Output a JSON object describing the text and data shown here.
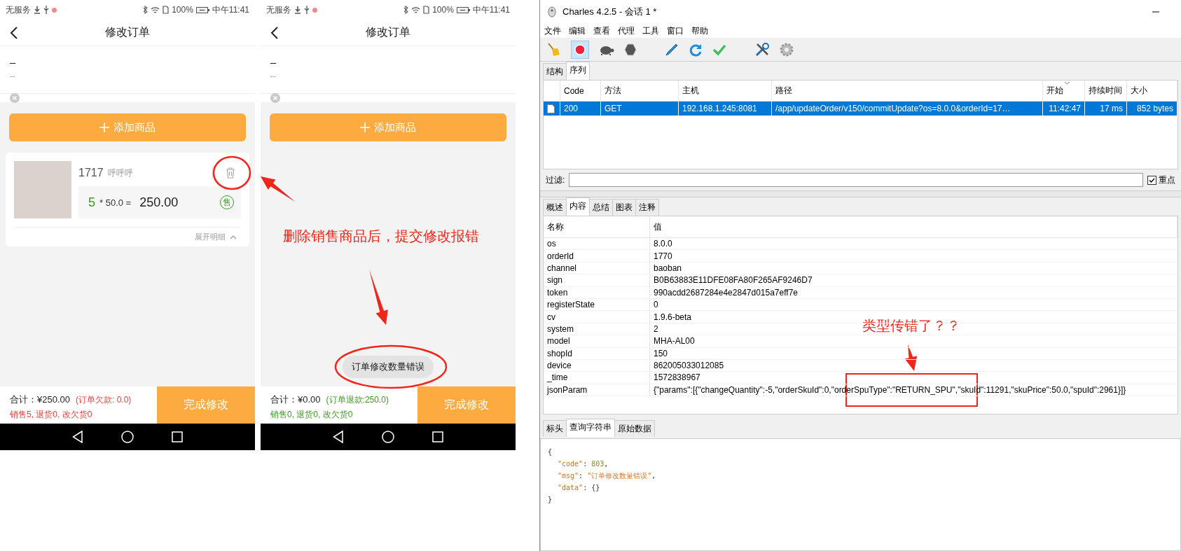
{
  "phones": [
    {
      "status_bar": {
        "carrier": "无服务",
        "battery": "100%",
        "time": "中午11:41"
      },
      "title": "修改订单",
      "customer": {
        "name": "–",
        "phone": "--"
      },
      "add_button": "添加商品",
      "items": [
        {
          "code": "1717",
          "name": "呼呼呼",
          "quantity": "5",
          "price": "* 50.0 =",
          "total": "250.00",
          "tag": "售",
          "expand": "展开明细"
        }
      ],
      "footer": {
        "total": "合计：¥250.00",
        "balance": "(订单欠款: 0.0)",
        "summary": "销售5, 退货0, 改欠货0",
        "color": "#e8413c"
      },
      "submit": "完成修改"
    },
    {
      "status_bar": {
        "carrier": "无服务",
        "battery": "100%",
        "time": "中午11:41"
      },
      "title": "修改订单",
      "customer": {
        "name": "–",
        "phone": "--"
      },
      "add_button": "添加商品",
      "toast": "订单修改数量错误",
      "footer": {
        "total": "合计：¥0.00",
        "balance": "(订单退款:250.0)",
        "summary": "销售0, 退货0, 改欠货0",
        "color": "#3f9a23"
      },
      "submit": "完成修改"
    }
  ],
  "charles": {
    "title": "Charles 4.2.5 - 会话 1 *",
    "menu": [
      "文件",
      "编辑",
      "查看",
      "代理",
      "工具",
      "窗口",
      "帮助"
    ],
    "toolbar": {
      "recording": true
    },
    "view_tabs": [
      {
        "label": "结构",
        "selected": false
      },
      {
        "label": "序列",
        "selected": true
      }
    ],
    "table": {
      "columns": [
        {
          "label": "Code",
          "sorted": false
        },
        {
          "label": "方法",
          "sorted": false
        },
        {
          "label": "主机",
          "sorted": false
        },
        {
          "label": "路径",
          "sorted": false
        },
        {
          "label": "开始",
          "sorted": true
        },
        {
          "label": "持续时间",
          "sorted": false
        },
        {
          "label": "大小",
          "sorted": false
        }
      ],
      "rows": [
        {
          "cells": [
            "200",
            "GET",
            "192.168.1.245:8081",
            "/app/updateOrder/v150/commitUpdate?os=8.0.0&orderId=17…",
            "11:42:47",
            "17 ms",
            "852 bytes"
          ],
          "selected": true
        }
      ]
    },
    "filter": {
      "label": "过滤:",
      "highlight": {
        "label": "重点",
        "checked": true
      }
    },
    "detail_tabs": [
      {
        "label": "概述",
        "selected": false
      },
      {
        "label": "内容",
        "selected": true
      },
      {
        "label": "总结",
        "selected": false
      },
      {
        "label": "图表",
        "selected": false
      },
      {
        "label": "注释",
        "selected": false
      }
    ],
    "params": {
      "columns": [
        "名称",
        "值"
      ],
      "rows": [
        {
          "name": "os",
          "value": "8.0.0"
        },
        {
          "name": "orderId",
          "value": "1770"
        },
        {
          "name": "channel",
          "value": "baoban"
        },
        {
          "name": "sign",
          "value": "B0B63883E11DFE08FA80F265AF9246D7"
        },
        {
          "name": "token",
          "value": "990acdd2687284e4e2847d015a7eff7e"
        },
        {
          "name": "registerState",
          "value": "0"
        },
        {
          "name": "cv",
          "value": "1.9.6-beta"
        },
        {
          "name": "system",
          "value": "2"
        },
        {
          "name": "model",
          "value": "MHA-AL00"
        },
        {
          "name": "shopId",
          "value": "150"
        },
        {
          "name": "device",
          "value": "862005033012085"
        },
        {
          "name": "_time",
          "value": "1572838967"
        },
        {
          "name": "jsonParam",
          "value": "{\"params\":[{\"changeQuantity\":-5,\"orderSkuId\":0,\"orderSpuType\":\"RETURN_SPU\",\"skuId\":11291,\"skuPrice\":50.0,\"spuId\":2961}]}"
        }
      ]
    },
    "body_tabs": [
      {
        "label": "标头",
        "selected": false
      },
      {
        "label": "查询字符串",
        "selected": true
      },
      {
        "label": "原始数据",
        "selected": false
      }
    ],
    "response_lines": [
      [
        {
          "kind": "punct",
          "text": "{"
        }
      ],
      [
        {
          "kind": "key",
          "text": "\"code\""
        },
        {
          "kind": "punct",
          "text": ": "
        },
        {
          "kind": "number",
          "text": "803"
        },
        {
          "kind": "punct",
          "text": ","
        }
      ],
      [
        {
          "kind": "key",
          "text": "\"msg\""
        },
        {
          "kind": "punct",
          "text": ": "
        },
        {
          "kind": "string",
          "text": "\"订单修改数量错误\""
        },
        {
          "kind": "punct",
          "text": ","
        }
      ],
      [
        {
          "kind": "key",
          "text": "\"data\""
        },
        {
          "kind": "punct",
          "text": ": {}"
        }
      ],
      [
        {
          "kind": "punct",
          "text": "}"
        }
      ]
    ]
  },
  "annotations": [
    {
      "kind": "phone-note",
      "text": "删除销售商品后，提交修改报错"
    },
    {
      "kind": "charles-note",
      "text": "类型传错了？？"
    }
  ]
}
